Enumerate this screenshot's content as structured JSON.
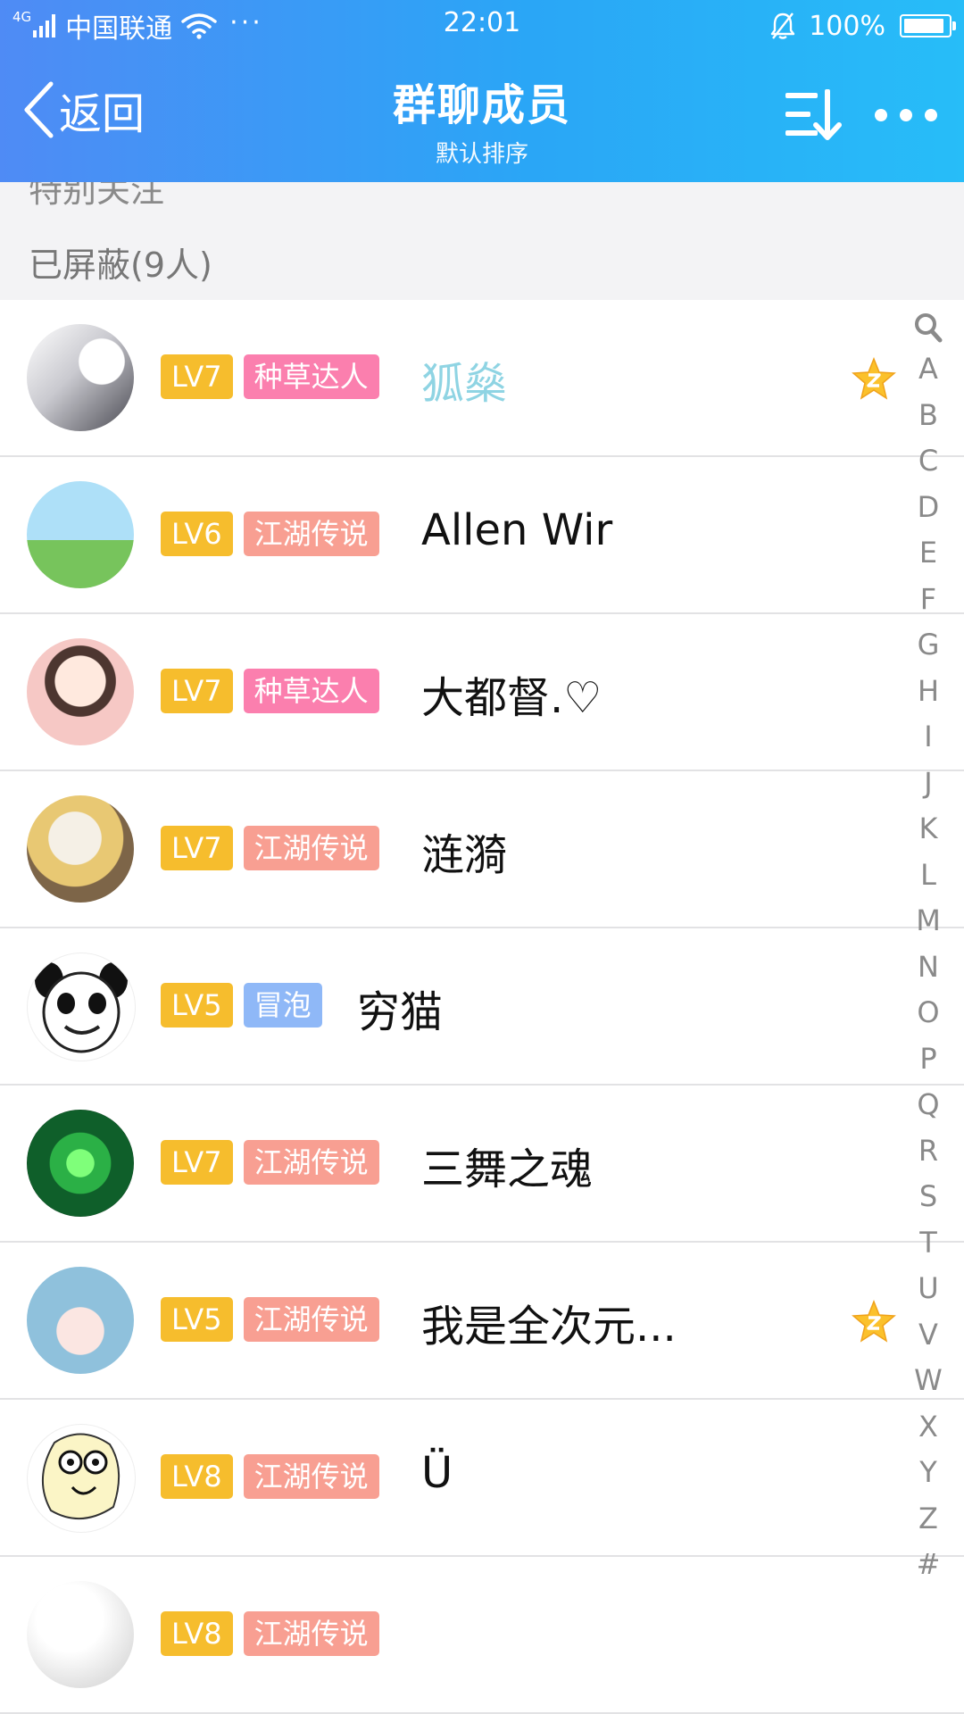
{
  "status_bar": {
    "network": "4G",
    "carrier": "中国联通",
    "more": "···",
    "time": "22:01",
    "battery_percent_label": "100%",
    "battery_level": 1.0
  },
  "title_bar": {
    "back_label": "返回",
    "title": "群聊成员",
    "subtitle": "默认排序"
  },
  "sections": {
    "partial_label": "特别关注",
    "blocked_label": "已屏蔽(9人)"
  },
  "colors": {
    "header_gradient": [
      "#4f8bf5",
      "#27bdf8"
    ],
    "level_badge": "#f6bd2d",
    "title_badge_pink": "#fb7fae",
    "title_badge_salmon": "#f89f92",
    "title_badge_blue": "#8fb8f7",
    "special_name": "#8fd4e3"
  },
  "members": [
    {
      "level": "LV7",
      "title": "种草达人",
      "name": "狐燊",
      "starred": true
    },
    {
      "level": "LV6",
      "title": "江湖传说",
      "name": "Allen Wir",
      "starred": false
    },
    {
      "level": "LV7",
      "title": "种草达人",
      "name": "大都督.♡",
      "starred": false
    },
    {
      "level": "LV7",
      "title": "江湖传说",
      "name": "涟漪",
      "starred": false
    },
    {
      "level": "LV5",
      "title": "冒泡",
      "name": "穷猫",
      "starred": false
    },
    {
      "level": "LV7",
      "title": "江湖传说",
      "name": "三舞之魂",
      "starred": false
    },
    {
      "level": "LV5",
      "title": "江湖传说",
      "name": "我是全次元...",
      "starred": true
    },
    {
      "level": "LV8",
      "title": "江湖传说",
      "name": "Ü",
      "starred": false
    },
    {
      "level": "LV8",
      "title": "江湖传说",
      "name": "",
      "starred": false
    }
  ],
  "alphabet_index": [
    "A",
    "B",
    "C",
    "D",
    "E",
    "F",
    "G",
    "H",
    "I",
    "J",
    "K",
    "L",
    "M",
    "N",
    "O",
    "P",
    "Q",
    "R",
    "S",
    "T",
    "U",
    "V",
    "W",
    "X",
    "Y",
    "Z",
    "#"
  ]
}
